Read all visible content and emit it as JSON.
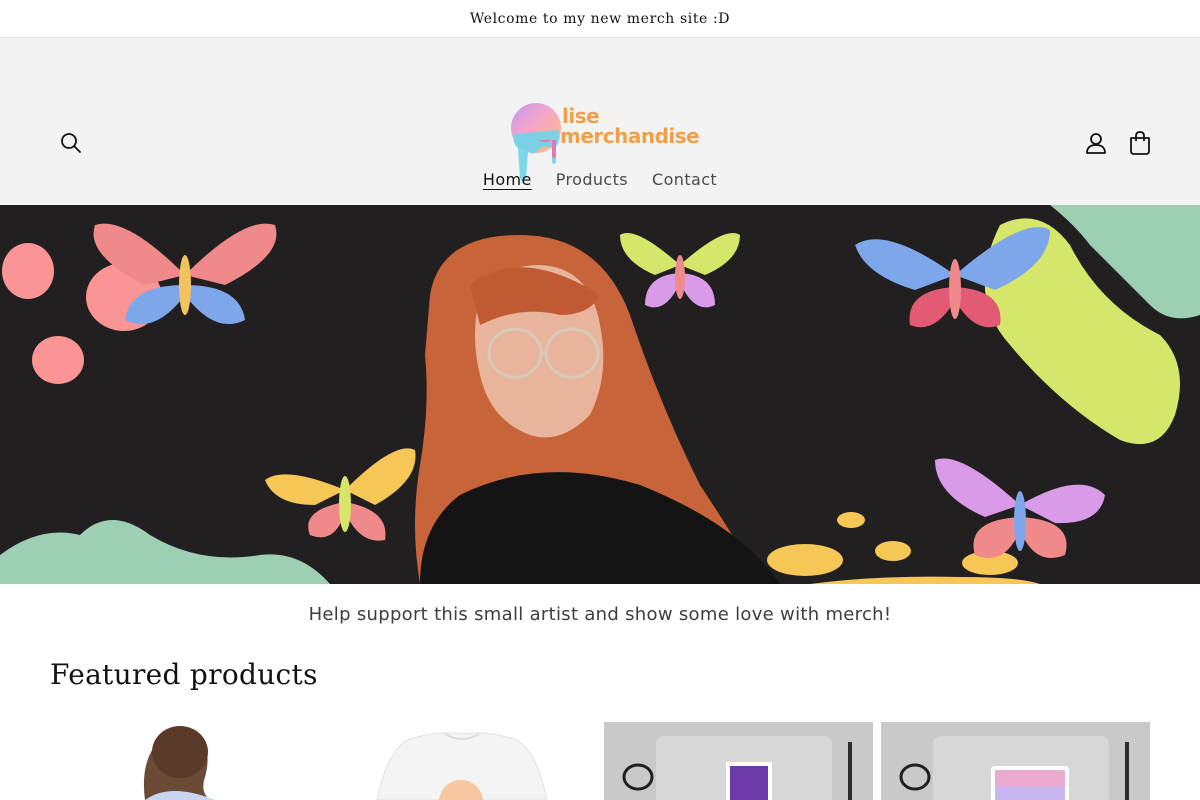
{
  "announcement": {
    "text": "Welcome to my new merch site :D"
  },
  "header": {
    "logo": {
      "line1": "lise",
      "line2": "merchandise"
    },
    "icons": {
      "search": "search-icon",
      "account": "user-icon",
      "cart": "cart-icon"
    },
    "nav": [
      {
        "label": "Home",
        "active": true
      },
      {
        "label": "Products",
        "active": false
      },
      {
        "label": "Contact",
        "active": false
      }
    ]
  },
  "hero": {
    "colors": {
      "background": "#211f20",
      "pink": "#fb9494",
      "green": "#9dcfb3",
      "lime": "#d5e66a",
      "yellow": "#f6c756",
      "hair": "#c8643a"
    }
  },
  "main": {
    "tagline": "Help support this small artist and show some love with merch!",
    "featured_title": "Featured products"
  },
  "colors": {
    "header_bg": "#f3f3f3",
    "logo_orange": "#f0a04b"
  }
}
